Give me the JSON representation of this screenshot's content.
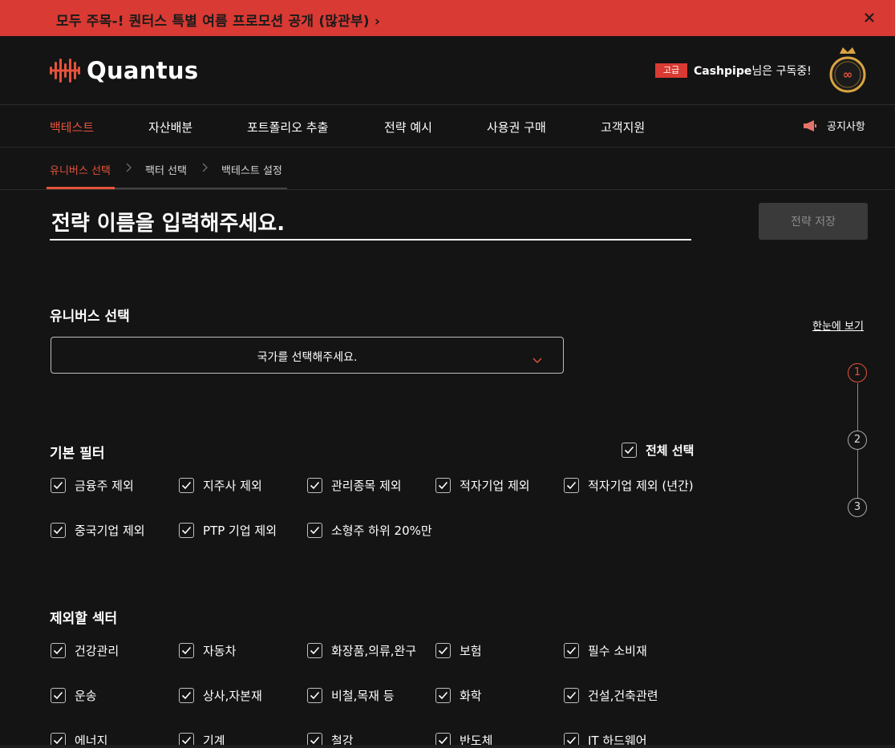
{
  "promo": {
    "text": "모두 주목-! 퀀터스 특별 여름 프로모션 공개 (많관부)",
    "arrow": "›"
  },
  "header": {
    "logo_text": "Quantus",
    "badge": "고급",
    "user_name": "Cashpipe",
    "subscribe_text": "님은 구독중!"
  },
  "nav": {
    "items": [
      {
        "label": "백테스트",
        "active": true
      },
      {
        "label": "자산배분"
      },
      {
        "label": "포트폴리오 추출"
      },
      {
        "label": "전략 예시"
      },
      {
        "label": "사용권 구매"
      },
      {
        "label": "고객지원"
      }
    ],
    "notice": "공지사항"
  },
  "steps": [
    "유니버스 선택",
    "팩터 선택",
    "백테스트 설정"
  ],
  "strategy": {
    "name_placeholder": "전략 이름을 입력해주세요.",
    "save_label": "전략 저장"
  },
  "universe": {
    "title": "유니버스 선택",
    "glance": "한눈에 보기",
    "country_placeholder": "국가를 선택해주세요."
  },
  "progress": [
    "1",
    "2",
    "3"
  ],
  "basic_filter": {
    "title": "기본 필터",
    "select_all": "전체 선택",
    "items": [
      "금융주 제외",
      "지주사 제외",
      "관리종목 제외",
      "적자기업 제외",
      "적자기업 제외 (년간)",
      "중국기업 제외",
      "PTP 기업 제외",
      "소형주 하위 20%만"
    ]
  },
  "sectors": {
    "title": "제외할 섹터",
    "items": [
      "건강관리",
      "자동차",
      "화장품,의류,완구",
      "보험",
      "필수 소비재",
      "운송",
      "상사,자본재",
      "비철,목재 등",
      "화학",
      "건설,건축관련",
      "에너지",
      "기계",
      "철강",
      "반도체",
      "IT 하드웨어"
    ]
  },
  "colors": {
    "accent": "#e5533c",
    "promo_bg": "#d93a33",
    "background": "#141414"
  }
}
